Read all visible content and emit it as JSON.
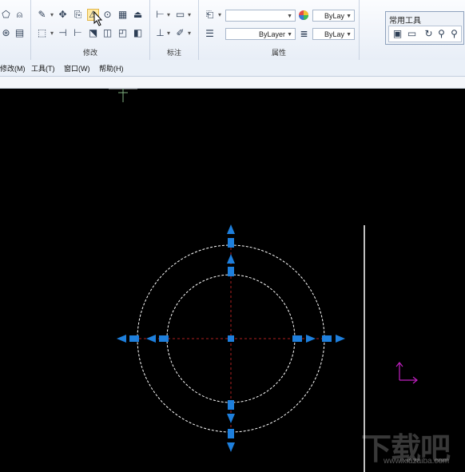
{
  "ribbon": {
    "groups": {
      "modify_title": "修改",
      "annotate_title": "标注",
      "properties_title": "属性"
    },
    "properties": {
      "layer_value": "",
      "color_value": "ByLay",
      "linetype_value": "ByLayer",
      "lineweight_value": "ByLay"
    },
    "float_panel": {
      "title": "常用工具"
    }
  },
  "menubar": {
    "items": [
      "修改(M)",
      "工具(T)",
      "窗口(W)",
      "帮助(H)"
    ]
  },
  "watermark": {
    "text": "下载吧",
    "url": "www.xiazaiba.com"
  },
  "colors": {
    "canvas": "#000000",
    "grip": "#1e7fdc",
    "circle": "#ffffff",
    "centerline": "#b02020",
    "ucs": "#c020c0"
  },
  "icons": [
    "move-icon",
    "copy-icon",
    "mirror-icon",
    "rotate-icon",
    "array-icon",
    "offset-icon",
    "trim-icon",
    "extend-icon",
    "scale-icon",
    "explode-icon",
    "linear-dimension-icon",
    "match-properties-icon",
    "color-wheel-icon",
    "lineweight-icon",
    "zoom-icon",
    "pan-icon"
  ]
}
